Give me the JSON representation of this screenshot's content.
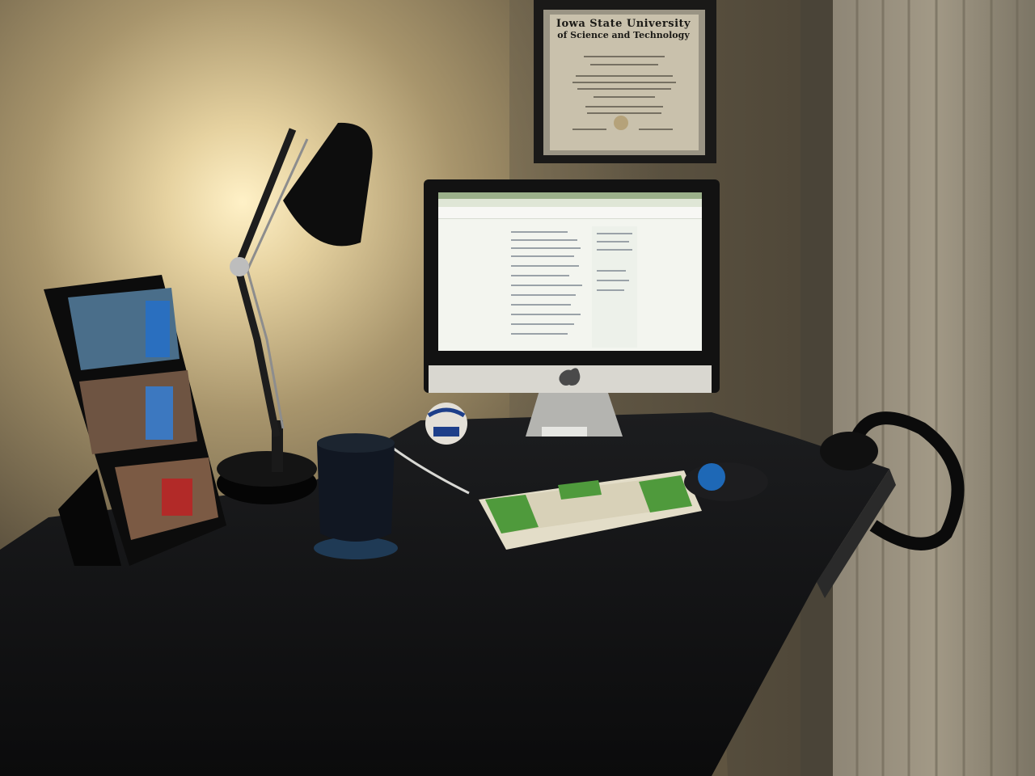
{
  "diploma": {
    "line1": "Iowa State University",
    "line2": "of Science and Technology"
  },
  "colors": {
    "wall": "#7e6e50",
    "lamp_glow": "#f6e2ae",
    "desk": "#111214",
    "screen": "#f3f5ef",
    "keycap_green": "#4f9a3c",
    "keycap_cream": "#ddd8c4"
  },
  "objects": [
    "photo-frame",
    "desk-lamp",
    "diploma-frame",
    "imac",
    "baseball",
    "mug",
    "mechanical-keyboard",
    "trackball",
    "headphones",
    "window-blinds"
  ]
}
